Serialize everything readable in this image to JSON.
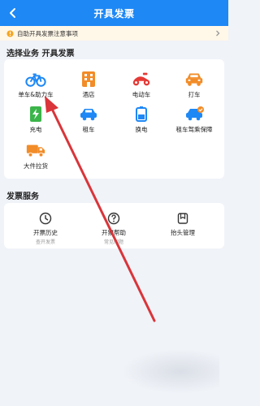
{
  "header": {
    "title": "开具发票",
    "back_icon": "chevron-left-icon"
  },
  "notice": {
    "text": "自助开具发票注意事项"
  },
  "business": {
    "title": "选择业务 开具发票",
    "items": [
      {
        "label": "单车&助力车",
        "icon": "bicycle-icon"
      },
      {
        "label": "酒店",
        "icon": "hotel-icon"
      },
      {
        "label": "电动车",
        "icon": "scooter-icon"
      },
      {
        "label": "打车",
        "icon": "taxi-icon"
      },
      {
        "label": "充电",
        "icon": "charging-icon"
      },
      {
        "label": "租车",
        "icon": "rental-car-icon"
      },
      {
        "label": "换电",
        "icon": "battery-swap-icon"
      },
      {
        "label": "租车驾乘保障",
        "icon": "car-insurance-icon"
      },
      {
        "label": "大件拉货",
        "icon": "truck-icon"
      }
    ]
  },
  "service": {
    "title": "发票服务",
    "items": [
      {
        "label": "开票历史",
        "sub": "查开发票",
        "icon": "clock-icon"
      },
      {
        "label": "开票帮助",
        "sub": "常见问题",
        "icon": "help-icon"
      },
      {
        "label": "抬头管理",
        "sub": "",
        "icon": "bookmark-icon"
      }
    ]
  },
  "colors": {
    "header_bg": "#1e88f5",
    "notice_bg": "#fff7e8",
    "page_bg": "#f0f3f8",
    "arrow": "#d9353a"
  }
}
